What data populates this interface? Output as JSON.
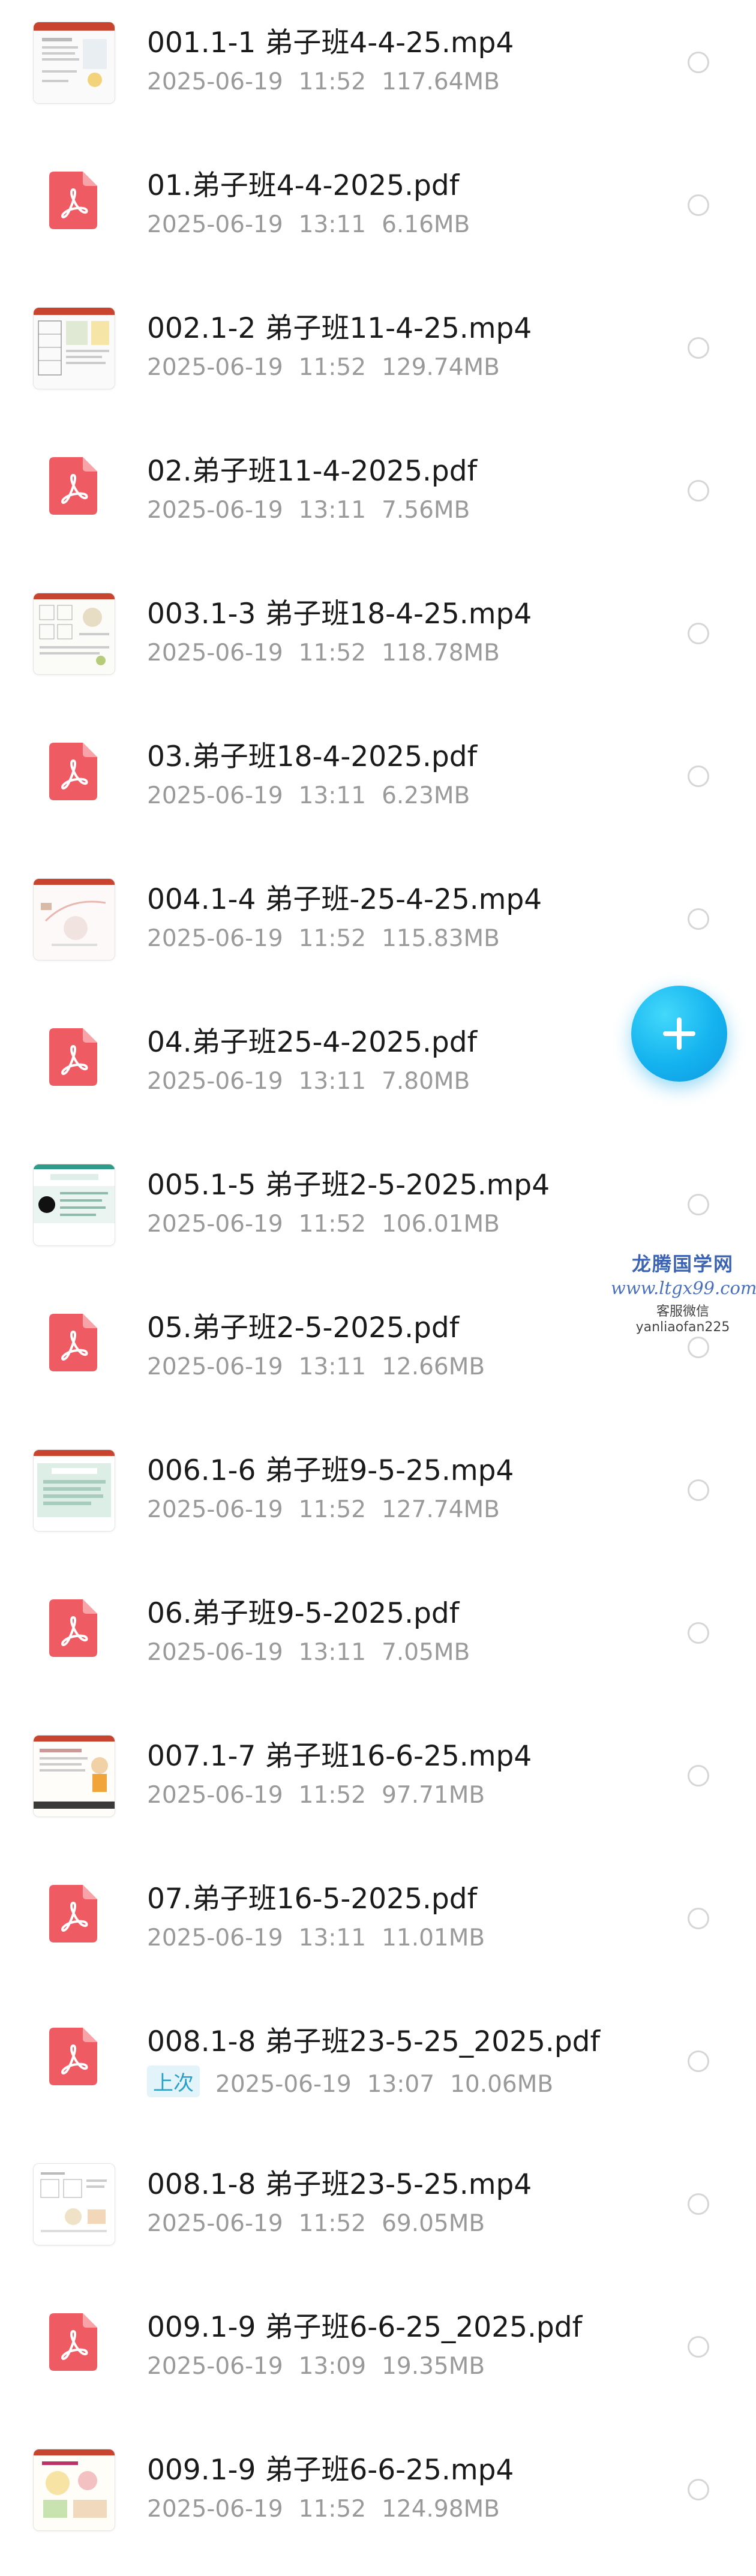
{
  "files": [
    {
      "name": "001.1-1 弟子班4-4-25.mp4",
      "date": "2025-06-19",
      "time": "11:52",
      "size": "117.64MB",
      "type": "video",
      "thumb": "thumbnail-1"
    },
    {
      "name": "01.弟子班4-4-2025.pdf",
      "date": "2025-06-19",
      "time": "13:11",
      "size": "6.16MB",
      "type": "pdf"
    },
    {
      "name": "002.1-2 弟子班11-4-25.mp4",
      "date": "2025-06-19",
      "time": "11:52",
      "size": "129.74MB",
      "type": "video",
      "thumb": "thumbnail-2"
    },
    {
      "name": "02.弟子班11-4-2025.pdf",
      "date": "2025-06-19",
      "time": "13:11",
      "size": "7.56MB",
      "type": "pdf"
    },
    {
      "name": "003.1-3 弟子班18-4-25.mp4",
      "date": "2025-06-19",
      "time": "11:52",
      "size": "118.78MB",
      "type": "video",
      "thumb": "thumbnail-3"
    },
    {
      "name": "03.弟子班18-4-2025.pdf",
      "date": "2025-06-19",
      "time": "13:11",
      "size": "6.23MB",
      "type": "pdf"
    },
    {
      "name": "004.1-4 弟子班-25-4-25.mp4",
      "date": "2025-06-19",
      "time": "11:52",
      "size": "115.83MB",
      "type": "video",
      "thumb": "thumbnail-4"
    },
    {
      "name": "04.弟子班25-4-2025.pdf",
      "date": "2025-06-19",
      "time": "13:11",
      "size": "7.80MB",
      "type": "pdf"
    },
    {
      "name": "005.1-5 弟子班2-5-2025.mp4",
      "date": "2025-06-19",
      "time": "11:52",
      "size": "106.01MB",
      "type": "video",
      "thumb": "thumbnail-5"
    },
    {
      "name": "05.弟子班2-5-2025.pdf",
      "date": "2025-06-19",
      "time": "13:11",
      "size": "12.66MB",
      "type": "pdf"
    },
    {
      "name": "006.1-6 弟子班9-5-25.mp4",
      "date": "2025-06-19",
      "time": "11:52",
      "size": "127.74MB",
      "type": "video",
      "thumb": "thumbnail-6"
    },
    {
      "name": "06.弟子班9-5-2025.pdf",
      "date": "2025-06-19",
      "time": "13:11",
      "size": "7.05MB",
      "type": "pdf"
    },
    {
      "name": "007.1-7 弟子班16-6-25.mp4",
      "date": "2025-06-19",
      "time": "11:52",
      "size": "97.71MB",
      "type": "video",
      "thumb": "thumbnail-7"
    },
    {
      "name": "07.弟子班16-5-2025.pdf",
      "date": "2025-06-19",
      "time": "13:11",
      "size": "11.01MB",
      "type": "pdf"
    },
    {
      "name": "008.1-8 弟子班23-5-25_2025.pdf",
      "badge": "上次",
      "date": "2025-06-19",
      "time": "13:07",
      "size": "10.06MB",
      "type": "pdf"
    },
    {
      "name": "008.1-8 弟子班23-5-25.mp4",
      "date": "2025-06-19",
      "time": "11:52",
      "size": "69.05MB",
      "type": "video",
      "thumb": "thumbnail-8"
    },
    {
      "name": "009.1-9 弟子班6-6-25_2025.pdf",
      "date": "2025-06-19",
      "time": "13:09",
      "size": "19.35MB",
      "type": "pdf"
    },
    {
      "name": "009.1-9 弟子班6-6-25.mp4",
      "date": "2025-06-19",
      "time": "11:52",
      "size": "124.98MB",
      "type": "video",
      "thumb": "thumbnail-9"
    }
  ],
  "fab": {
    "icon": "plus-icon",
    "color": "#14b3ef"
  },
  "watermark": {
    "title": "龙腾国学网",
    "url": "www.ltgx99.com",
    "contact": "客服微信 yanliaofan225"
  },
  "colors": {
    "pdf_icon": "#ef5b63",
    "file_name": "#1a1a1a",
    "meta": "#9a9a9a",
    "badge_bg": "#e3f3fa",
    "badge_text": "#2aa0c6"
  }
}
